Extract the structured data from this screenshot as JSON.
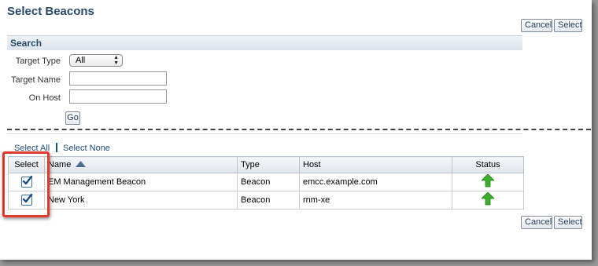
{
  "title": "Select Beacons",
  "toolbar_top": {
    "cancel_label": "Cancel",
    "select_label": "Select"
  },
  "search": {
    "title": "Search",
    "target_type_label": "Target Type",
    "target_type_value": "All",
    "target_name_label": "Target Name",
    "target_name_value": "",
    "on_host_label": "On Host",
    "on_host_value": "",
    "go_label": "Go"
  },
  "selection_links": {
    "select_all": "Select All",
    "select_none": "Select None"
  },
  "table": {
    "headers": {
      "select": "Select",
      "name": "Name",
      "type": "Type",
      "host": "Host",
      "status": "Status"
    },
    "sort": {
      "column": "Name",
      "direction": "ascending"
    },
    "rows": [
      {
        "selected": true,
        "name": "EM Management Beacon",
        "type": "Beacon",
        "host": "emcc.example.com",
        "status": "up"
      },
      {
        "selected": true,
        "name": "New York",
        "type": "Beacon",
        "host": "rnm-xe",
        "status": "up"
      }
    ]
  },
  "toolbar_bottom": {
    "cancel_label": "Cancel",
    "select_label": "Select"
  },
  "colors": {
    "title": "#2a4a6b",
    "link": "#1f4e79",
    "highlight": "#e03a2a",
    "status_up": "#3cae2c"
  }
}
